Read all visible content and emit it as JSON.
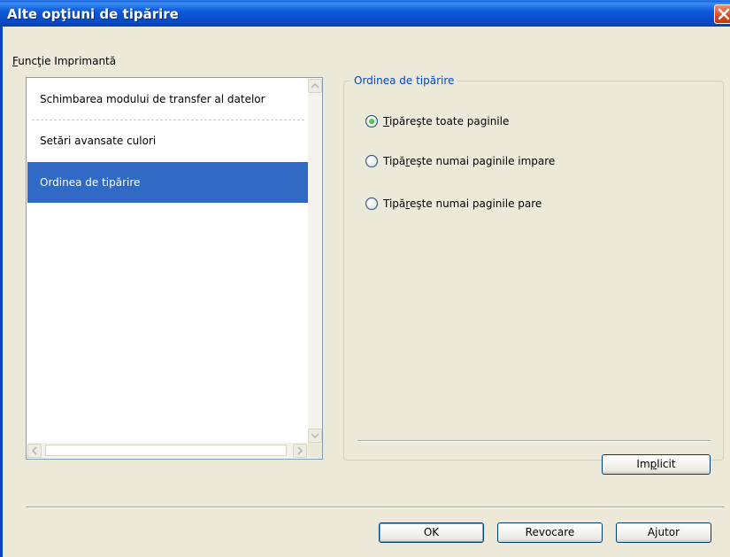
{
  "window": {
    "title": "Alte opţiuni de tipărire"
  },
  "sidebar": {
    "group_label_access": "F",
    "group_label_rest": "uncţie Imprimantă",
    "items": [
      {
        "label": "Schimbarea modului de transfer al datelor",
        "selected": false
      },
      {
        "label": "Setări avansate culori",
        "selected": false
      },
      {
        "label": "Ordinea de tipărire",
        "selected": true
      }
    ]
  },
  "panel": {
    "group_title": "Ordinea de tipărire",
    "options": [
      {
        "access": "T",
        "rest": "ipăreşte toate paginile",
        "checked": true
      },
      {
        "pre": "Tipă",
        "access": "r",
        "rest": "eşte numai paginile impare",
        "checked": false
      },
      {
        "pre": "Tipă",
        "access": "r",
        "rest": "eşte numai paginile pare",
        "checked": false
      }
    ],
    "default_button": {
      "pre": "Im",
      "access": "p",
      "rest": "licit"
    }
  },
  "footer": {
    "ok_label": "OK",
    "cancel_label": "Revocare",
    "help_label": "Ajutor"
  },
  "colors": {
    "title_bar": "#0a5fd6",
    "selection": "#316ac5",
    "group_title": "#0046d5",
    "dialog_bg": "#ece9d8"
  }
}
